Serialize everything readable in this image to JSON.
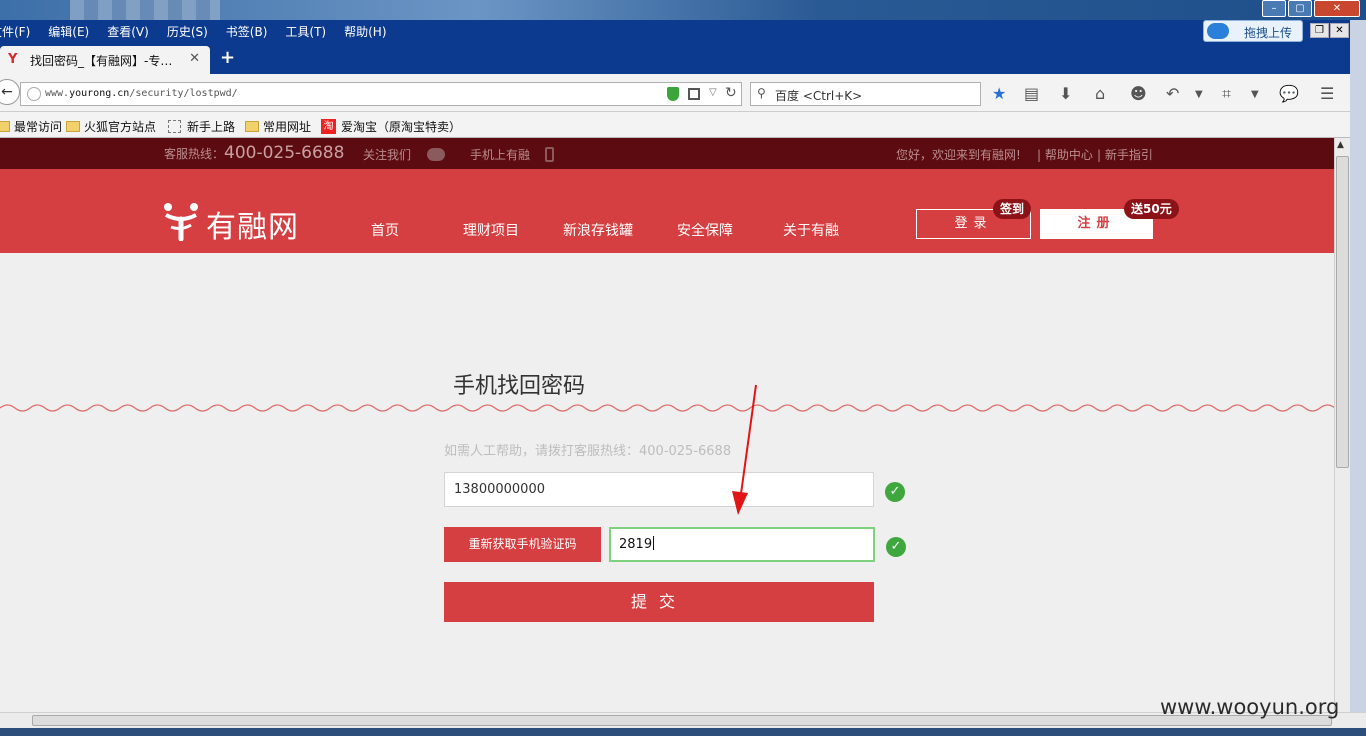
{
  "menubar": {
    "items": [
      "文件(F)",
      "编辑(E)",
      "查看(V)",
      "历史(S)",
      "书签(B)",
      "工具(T)",
      "帮助(H)"
    ],
    "upload_label": "拖拽上传"
  },
  "tab": {
    "title": "找回密码_【有融网】-专…",
    "new_tab": "+"
  },
  "address": {
    "url_prefix": "www.",
    "url_domain": "yourong.cn",
    "url_path": "/security/lostpwd/",
    "search_placeholder": "百度 <Ctrl+K>"
  },
  "bookmarks": [
    "最常访问",
    "火狐官方站点",
    "新手上路",
    "常用网址",
    "爱淘宝（原淘宝特卖）"
  ],
  "site": {
    "hotline_label": "客服热线：",
    "hotline_number": "400-025-6688",
    "follow": "关注我们",
    "mobile": "手机上有融",
    "welcome": "您好，欢迎来到有融网!",
    "help_center": "| 帮助中心",
    "guide": "| 新手指引",
    "logo_text": "有融网",
    "nav": [
      "首页",
      "理财项目",
      "新浪存钱罐",
      "安全保障",
      "关于有融"
    ],
    "login": "登录",
    "register": "注册",
    "signin_badge": "签到",
    "bonus_badge": "送50元"
  },
  "form": {
    "title": "手机找回密码",
    "help": "如需人工帮助，请拨打客服热线：400-025-6688",
    "phone_value": "13800000000",
    "sms_button": "重新获取手机验证码",
    "code_value": "2819",
    "submit": "提交"
  },
  "colors": {
    "brand_red": "#d63f42",
    "top_strip": "#5c0c11",
    "success_green": "#3ea83e",
    "badge_dark": "#8b1216"
  },
  "watermark": "www.wooyun.org"
}
